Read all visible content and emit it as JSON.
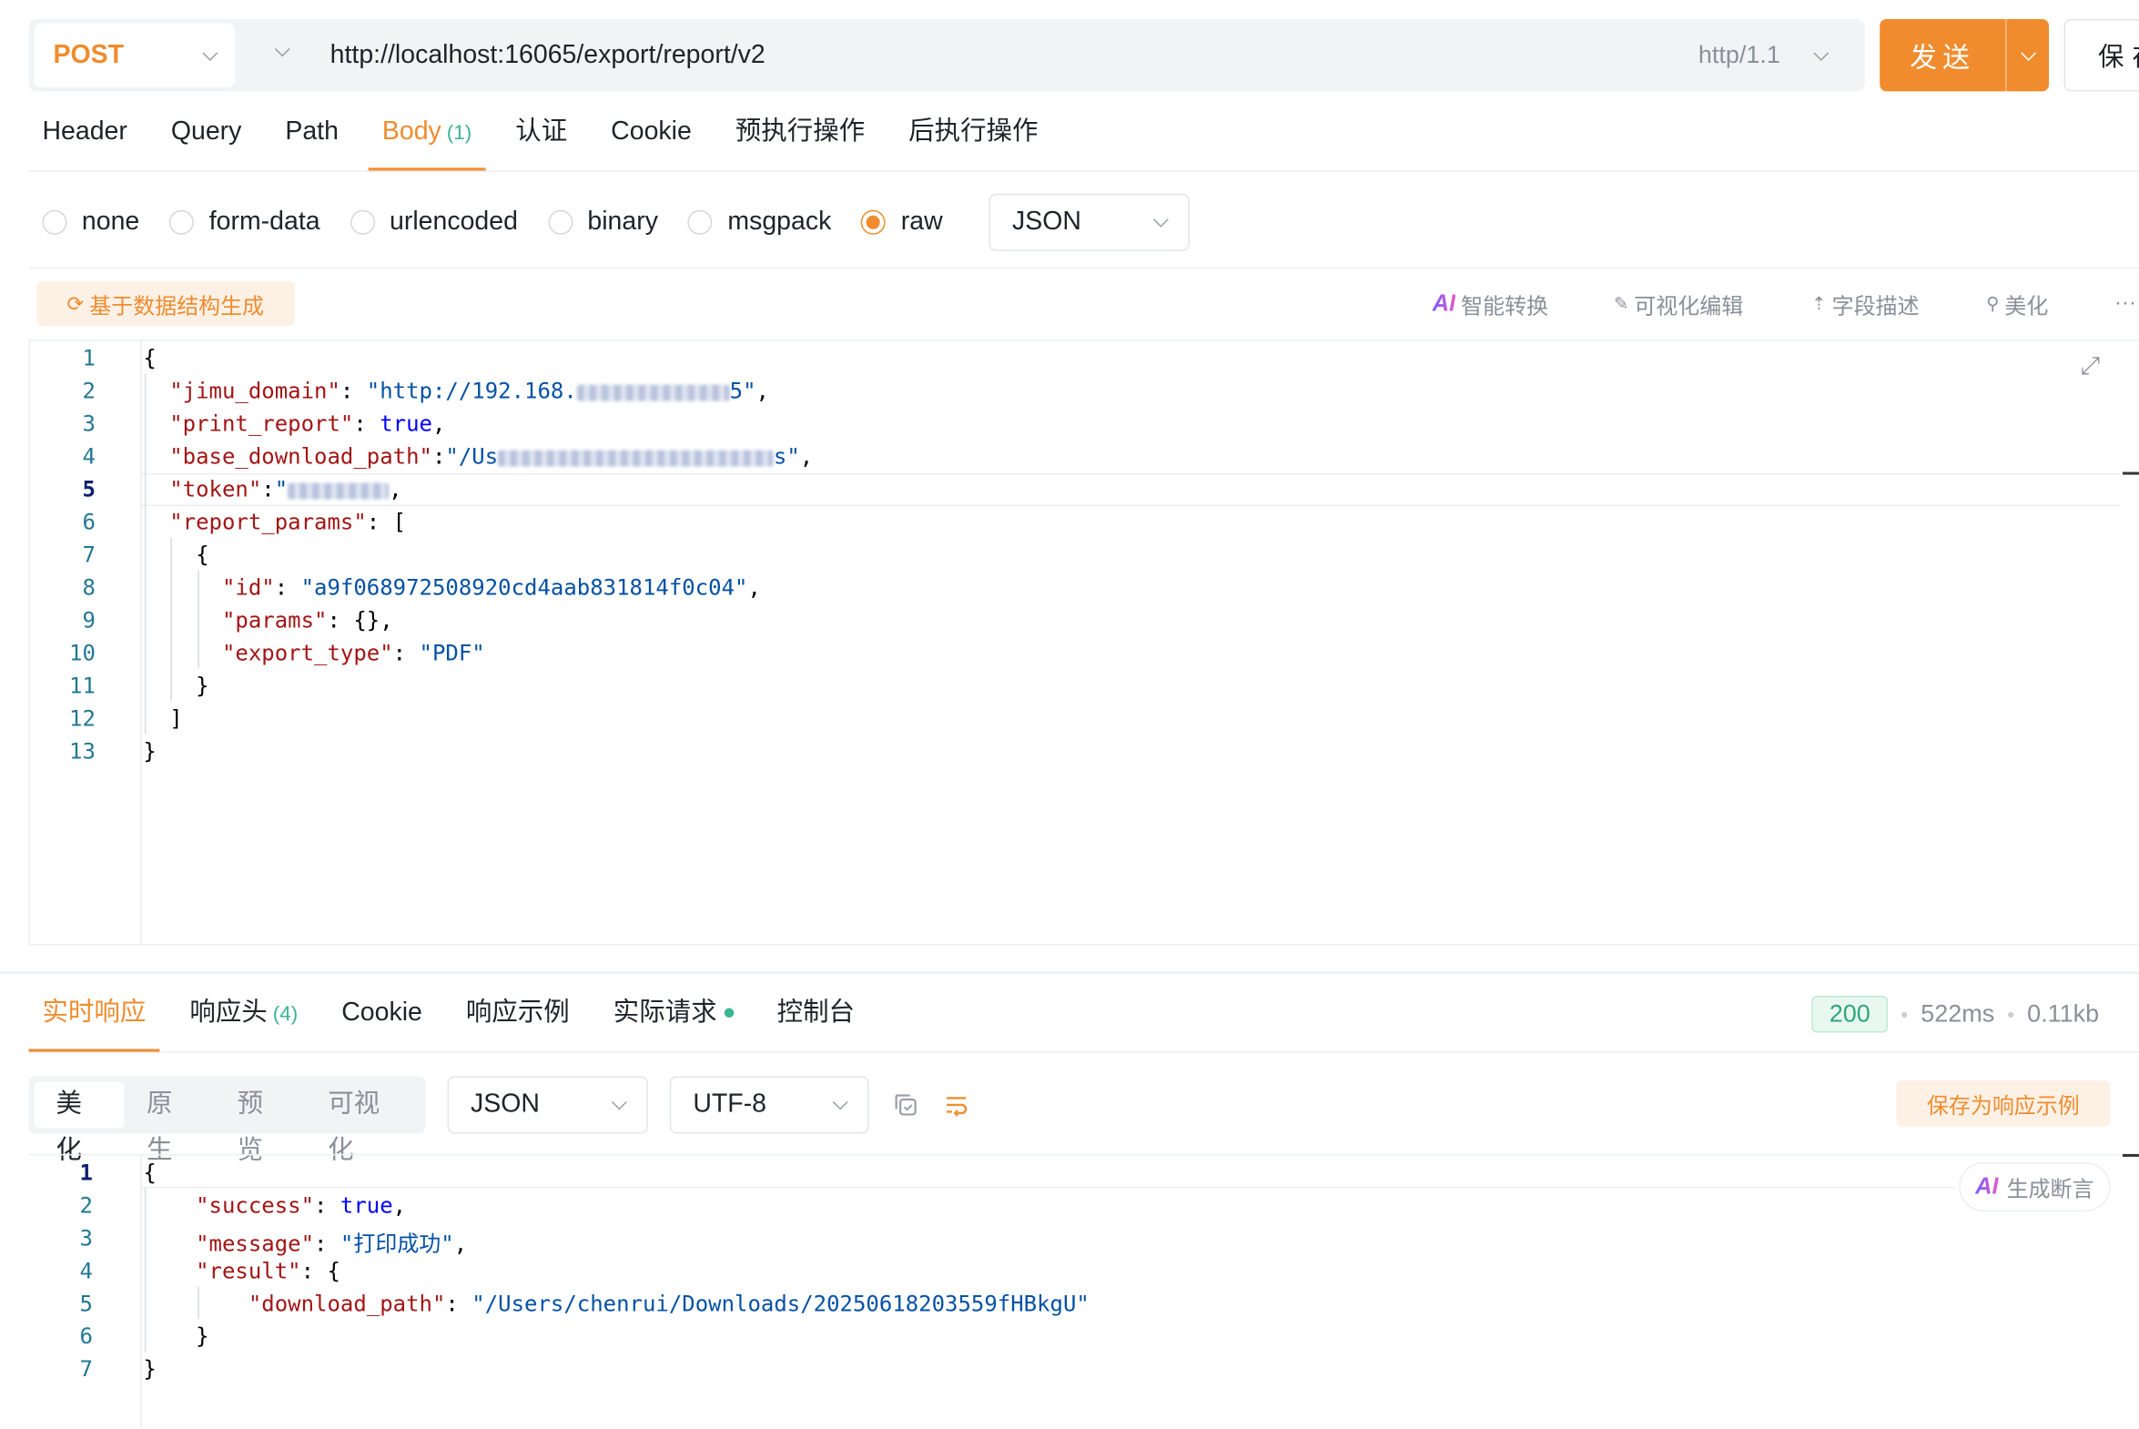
{
  "request": {
    "method": "POST",
    "url": "http://localhost:16065/export/report/v2",
    "protocol": "http/1.1",
    "send_label": "发送",
    "save_label": "保存"
  },
  "tabs": [
    {
      "label": "Header"
    },
    {
      "label": "Query"
    },
    {
      "label": "Path"
    },
    {
      "label": "Body",
      "count": "(1)"
    },
    {
      "label": "认证"
    },
    {
      "label": "Cookie"
    },
    {
      "label": "预执行操作"
    },
    {
      "label": "后执行操作"
    }
  ],
  "body_types": {
    "options": [
      "none",
      "form-data",
      "urlencoded",
      "binary",
      "msgpack",
      "raw"
    ],
    "selected": "raw",
    "format": "JSON"
  },
  "editor_toolbar": {
    "generate": "基于数据结构生成",
    "ai_convert": "智能转换",
    "visual_edit": "可视化编辑",
    "field_desc": "字段描述",
    "beautify": "美化",
    "more": "···"
  },
  "request_body_lines": [
    "1",
    "2",
    "3",
    "4",
    "5",
    "6",
    "7",
    "8",
    "9",
    "10",
    "11",
    "12",
    "13"
  ],
  "request_body": {
    "jimu_domain_prefix": "\"http://192.168.",
    "jimu_domain_suffix": "5\"",
    "print_report": "true",
    "base_path_prefix": "\"/Us",
    "base_path_suffix": "s\"",
    "token_prefix": "\"",
    "id": "\"a9f068972508920cd4aab831814f0c04\"",
    "export_type": "\"PDF\""
  },
  "response_tabs": [
    {
      "label": "实时响应"
    },
    {
      "label": "响应头",
      "count": "(4)"
    },
    {
      "label": "Cookie"
    },
    {
      "label": "响应示例"
    },
    {
      "label": "实际请求"
    },
    {
      "label": "控制台"
    }
  ],
  "response_status": {
    "code": "200",
    "time": "522ms",
    "size": "0.11kb"
  },
  "response_view": {
    "modes": [
      "美化",
      "原生",
      "预览",
      "可视化"
    ],
    "selected": "美化",
    "format": "JSON",
    "encoding": "UTF-8",
    "save_example": "保存为响应示例",
    "generate_assertion": "生成断言"
  },
  "response_body": {
    "success": "true",
    "message": "\"打印成功\"",
    "download_path": "\"/Users/chenrui/Downloads/20250618203559fHBkgU\""
  },
  "colors": {
    "accent": "#f08c2e",
    "success": "#2ea77a"
  }
}
